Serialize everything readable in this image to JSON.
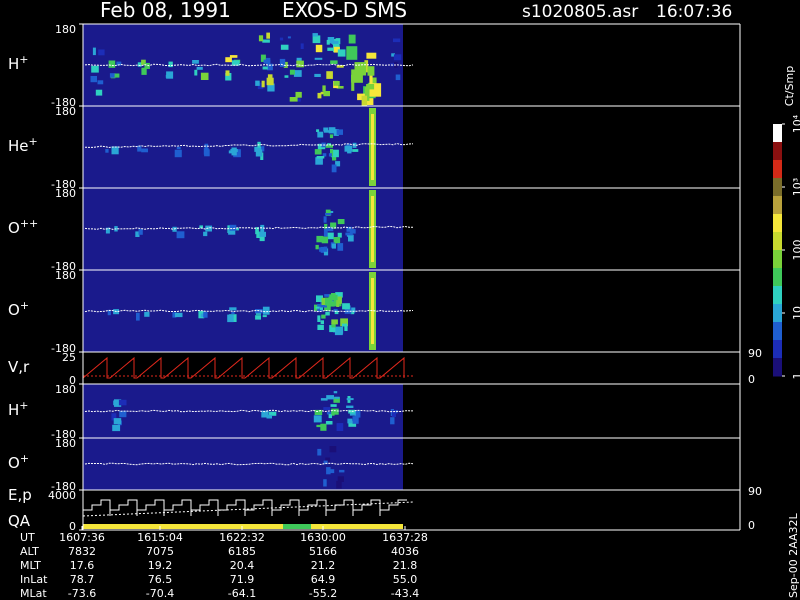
{
  "header": {
    "date": "Feb 08, 1991",
    "instrument": "EXOS-D SMS",
    "file": "s1020805.asr",
    "time": "16:07:36"
  },
  "colorbar": {
    "unit_label": "Ct/Smp",
    "ticks": [
      {
        "label": "1",
        "value": 1
      },
      {
        "label": "10",
        "value": 10
      },
      {
        "label": "100",
        "value": 100
      },
      {
        "label": "10³",
        "value": 1000
      },
      {
        "label": "10⁴",
        "value": 10000
      }
    ],
    "colors": [
      "#1a0f78",
      "#1c2db8",
      "#1f5fd0",
      "#2aa6d6",
      "#2fd0c0",
      "#3fc85a",
      "#7ad23a",
      "#c8d92f",
      "#f5e63a",
      "#b9a23c",
      "#7a6d2a",
      "#d42a17",
      "#8a1010",
      "#ffffff"
    ]
  },
  "footer": {
    "version_label": "Sep-00 2AA32L",
    "rows": [
      {
        "label": "UT",
        "values": [
          "1607:36",
          "1615:04",
          "1622:32",
          "1630:00",
          "1637:28"
        ]
      },
      {
        "label": "ALT",
        "values": [
          "7832",
          "7075",
          "6185",
          "5166",
          "4036"
        ]
      },
      {
        "label": "MLT",
        "values": [
          "17.6",
          "19.2",
          "20.4",
          "21.2",
          "21.8"
        ]
      },
      {
        "label": "InLat",
        "values": [
          "78.7",
          "76.5",
          "71.9",
          "64.9",
          "55.0"
        ]
      },
      {
        "label": "MLat",
        "values": [
          "-73.6",
          "-70.4",
          "-64.1",
          "-55.2",
          "-43.4"
        ]
      }
    ]
  },
  "chart_data": [
    {
      "type": "heatmap",
      "panel": "H+",
      "label": "H",
      "superscript": "+",
      "ylim": [
        -180,
        180
      ],
      "ytick_labels": [
        "180",
        "-180"
      ],
      "xlim": [
        "1607:36",
        "1637:28"
      ]
    },
    {
      "type": "heatmap",
      "panel": "He+",
      "label": "He",
      "superscript": "+",
      "ylim": [
        -180,
        180
      ],
      "ytick_labels": [
        "180",
        "-180"
      ],
      "xlim": [
        "1607:36",
        "1637:28"
      ]
    },
    {
      "type": "heatmap",
      "panel": "O++",
      "label": "O",
      "superscript": "++",
      "ylim": [
        -180,
        180
      ],
      "ytick_labels": [
        "180",
        "-180"
      ],
      "xlim": [
        "1607:36",
        "1637:28"
      ]
    },
    {
      "type": "heatmap",
      "panel": "O+",
      "label": "O",
      "superscript": "+",
      "ylim": [
        -180,
        180
      ],
      "ytick_labels": [
        "180",
        "-180"
      ],
      "xlim": [
        "1607:36",
        "1637:28"
      ]
    },
    {
      "type": "line",
      "panel": "V,r",
      "label": "V,r",
      "ylim": [
        0,
        25
      ],
      "ytick_labels": [
        "25",
        "0"
      ],
      "right_ticks": [
        "90",
        "0"
      ],
      "xlim": [
        "1607:36",
        "1637:28"
      ]
    },
    {
      "type": "heatmap",
      "panel": "H+ (lower)",
      "label": "H",
      "superscript": "+",
      "ylim": [
        -180,
        180
      ],
      "ytick_labels": [
        "180",
        "-180"
      ],
      "xlim": [
        "1607:36",
        "1637:28"
      ]
    },
    {
      "type": "heatmap",
      "panel": "O+ (lower)",
      "label": "O",
      "superscript": "+",
      "ylim": [
        -180,
        180
      ],
      "ytick_labels": [
        "180",
        "-180"
      ],
      "xlim": [
        "1607:36",
        "1637:28"
      ]
    },
    {
      "type": "line",
      "panel": "E,p / QA",
      "label": "E,p",
      "label2": "QA",
      "ylim": [
        0,
        4000
      ],
      "ytick_labels": [
        "4000",
        "0"
      ],
      "right_ticks": [
        "90",
        "0"
      ],
      "xlim": [
        "1607:36",
        "1637:28"
      ]
    }
  ]
}
